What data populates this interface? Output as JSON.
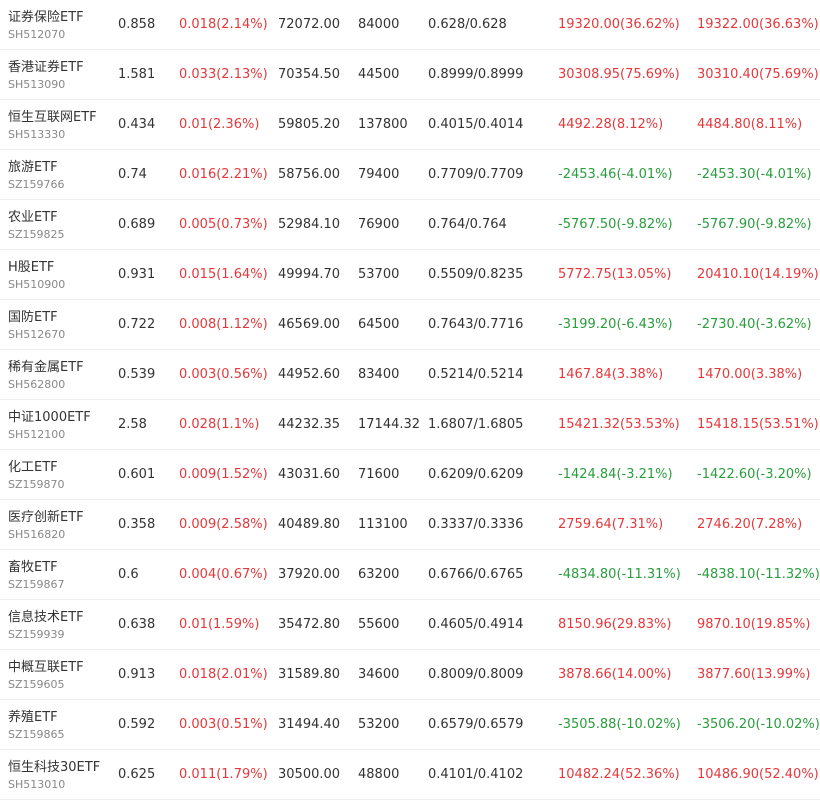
{
  "colors": {
    "up": "#e4393c",
    "down": "#2a9d3e",
    "text": "#333333",
    "subtext": "#888888"
  },
  "rows": [
    {
      "name": "证券保险ETF",
      "code": "SH512070",
      "price": "0.858",
      "change": "0.018(2.14%)",
      "amount": "72072.00",
      "volume": "84000",
      "bid_ask": "0.628/0.628",
      "pnl1": "19320.00(36.62%)",
      "pnl1_dir": "up",
      "pnl2": "19322.00(36.63%)",
      "pnl2_dir": "up"
    },
    {
      "name": "香港证券ETF",
      "code": "SH513090",
      "price": "1.581",
      "change": "0.033(2.13%)",
      "amount": "70354.50",
      "volume": "44500",
      "bid_ask": "0.8999/0.8999",
      "pnl1": "30308.95(75.69%)",
      "pnl1_dir": "up",
      "pnl2": "30310.40(75.69%)",
      "pnl2_dir": "up"
    },
    {
      "name": "恒生互联网ETF",
      "code": "SH513330",
      "price": "0.434",
      "change": "0.01(2.36%)",
      "amount": "59805.20",
      "volume": "137800",
      "bid_ask": "0.4015/0.4014",
      "pnl1": "4492.28(8.12%)",
      "pnl1_dir": "up",
      "pnl2": "4484.80(8.11%)",
      "pnl2_dir": "up"
    },
    {
      "name": "旅游ETF",
      "code": "SZ159766",
      "price": "0.74",
      "change": "0.016(2.21%)",
      "amount": "58756.00",
      "volume": "79400",
      "bid_ask": "0.7709/0.7709",
      "pnl1": "-2453.46(-4.01%)",
      "pnl1_dir": "down",
      "pnl2": "-2453.30(-4.01%)",
      "pnl2_dir": "down"
    },
    {
      "name": "农业ETF",
      "code": "SZ159825",
      "price": "0.689",
      "change": "0.005(0.73%)",
      "amount": "52984.10",
      "volume": "76900",
      "bid_ask": "0.764/0.764",
      "pnl1": "-5767.50(-9.82%)",
      "pnl1_dir": "down",
      "pnl2": "-5767.90(-9.82%)",
      "pnl2_dir": "down"
    },
    {
      "name": "H股ETF",
      "code": "SH510900",
      "price": "0.931",
      "change": "0.015(1.64%)",
      "amount": "49994.70",
      "volume": "53700",
      "bid_ask": "0.5509/0.8235",
      "pnl1": "5772.75(13.05%)",
      "pnl1_dir": "up",
      "pnl2": "20410.10(14.19%)",
      "pnl2_dir": "up"
    },
    {
      "name": "国防ETF",
      "code": "SH512670",
      "price": "0.722",
      "change": "0.008(1.12%)",
      "amount": "46569.00",
      "volume": "64500",
      "bid_ask": "0.7643/0.7716",
      "pnl1": "-3199.20(-6.43%)",
      "pnl1_dir": "down",
      "pnl2": "-2730.40(-3.62%)",
      "pnl2_dir": "down"
    },
    {
      "name": "稀有金属ETF",
      "code": "SH562800",
      "price": "0.539",
      "change": "0.003(0.56%)",
      "amount": "44952.60",
      "volume": "83400",
      "bid_ask": "0.5214/0.5214",
      "pnl1": "1467.84(3.38%)",
      "pnl1_dir": "up",
      "pnl2": "1470.00(3.38%)",
      "pnl2_dir": "up"
    },
    {
      "name": "中证1000ETF",
      "code": "SH512100",
      "price": "2.58",
      "change": "0.028(1.1%)",
      "amount": "44232.35",
      "volume": "17144.32",
      "bid_ask": "1.6807/1.6805",
      "pnl1": "15421.32(53.53%)",
      "pnl1_dir": "up",
      "pnl2": "15418.15(53.51%)",
      "pnl2_dir": "up"
    },
    {
      "name": "化工ETF",
      "code": "SZ159870",
      "price": "0.601",
      "change": "0.009(1.52%)",
      "amount": "43031.60",
      "volume": "71600",
      "bid_ask": "0.6209/0.6209",
      "pnl1": "-1424.84(-3.21%)",
      "pnl1_dir": "down",
      "pnl2": "-1422.60(-3.20%)",
      "pnl2_dir": "down"
    },
    {
      "name": "医疗创新ETF",
      "code": "SH516820",
      "price": "0.358",
      "change": "0.009(2.58%)",
      "amount": "40489.80",
      "volume": "113100",
      "bid_ask": "0.3337/0.3336",
      "pnl1": "2759.64(7.31%)",
      "pnl1_dir": "up",
      "pnl2": "2746.20(7.28%)",
      "pnl2_dir": "up"
    },
    {
      "name": "畜牧ETF",
      "code": "SZ159867",
      "price": "0.6",
      "change": "0.004(0.67%)",
      "amount": "37920.00",
      "volume": "63200",
      "bid_ask": "0.6766/0.6765",
      "pnl1": "-4834.80(-11.31%)",
      "pnl1_dir": "down",
      "pnl2": "-4838.10(-11.32%)",
      "pnl2_dir": "down"
    },
    {
      "name": "信息技术ETF",
      "code": "SZ159939",
      "price": "0.638",
      "change": "0.01(1.59%)",
      "amount": "35472.80",
      "volume": "55600",
      "bid_ask": "0.4605/0.4914",
      "pnl1": "8150.96(29.83%)",
      "pnl1_dir": "up",
      "pnl2": "9870.10(19.85%)",
      "pnl2_dir": "up"
    },
    {
      "name": "中概互联ETF",
      "code": "SZ159605",
      "price": "0.913",
      "change": "0.018(2.01%)",
      "amount": "31589.80",
      "volume": "34600",
      "bid_ask": "0.8009/0.8009",
      "pnl1": "3878.66(14.00%)",
      "pnl1_dir": "up",
      "pnl2": "3877.60(13.99%)",
      "pnl2_dir": "up"
    },
    {
      "name": "养殖ETF",
      "code": "SZ159865",
      "price": "0.592",
      "change": "0.003(0.51%)",
      "amount": "31494.40",
      "volume": "53200",
      "bid_ask": "0.6579/0.6579",
      "pnl1": "-3505.88(-10.02%)",
      "pnl1_dir": "down",
      "pnl2": "-3506.20(-10.02%)",
      "pnl2_dir": "down"
    },
    {
      "name": "恒生科技30ETF",
      "code": "SH513010",
      "price": "0.625",
      "change": "0.011(1.79%)",
      "amount": "30500.00",
      "volume": "48800",
      "bid_ask": "0.4101/0.4102",
      "pnl1": "10482.24(52.36%)",
      "pnl1_dir": "up",
      "pnl2": "10486.90(52.40%)",
      "pnl2_dir": "up"
    }
  ]
}
